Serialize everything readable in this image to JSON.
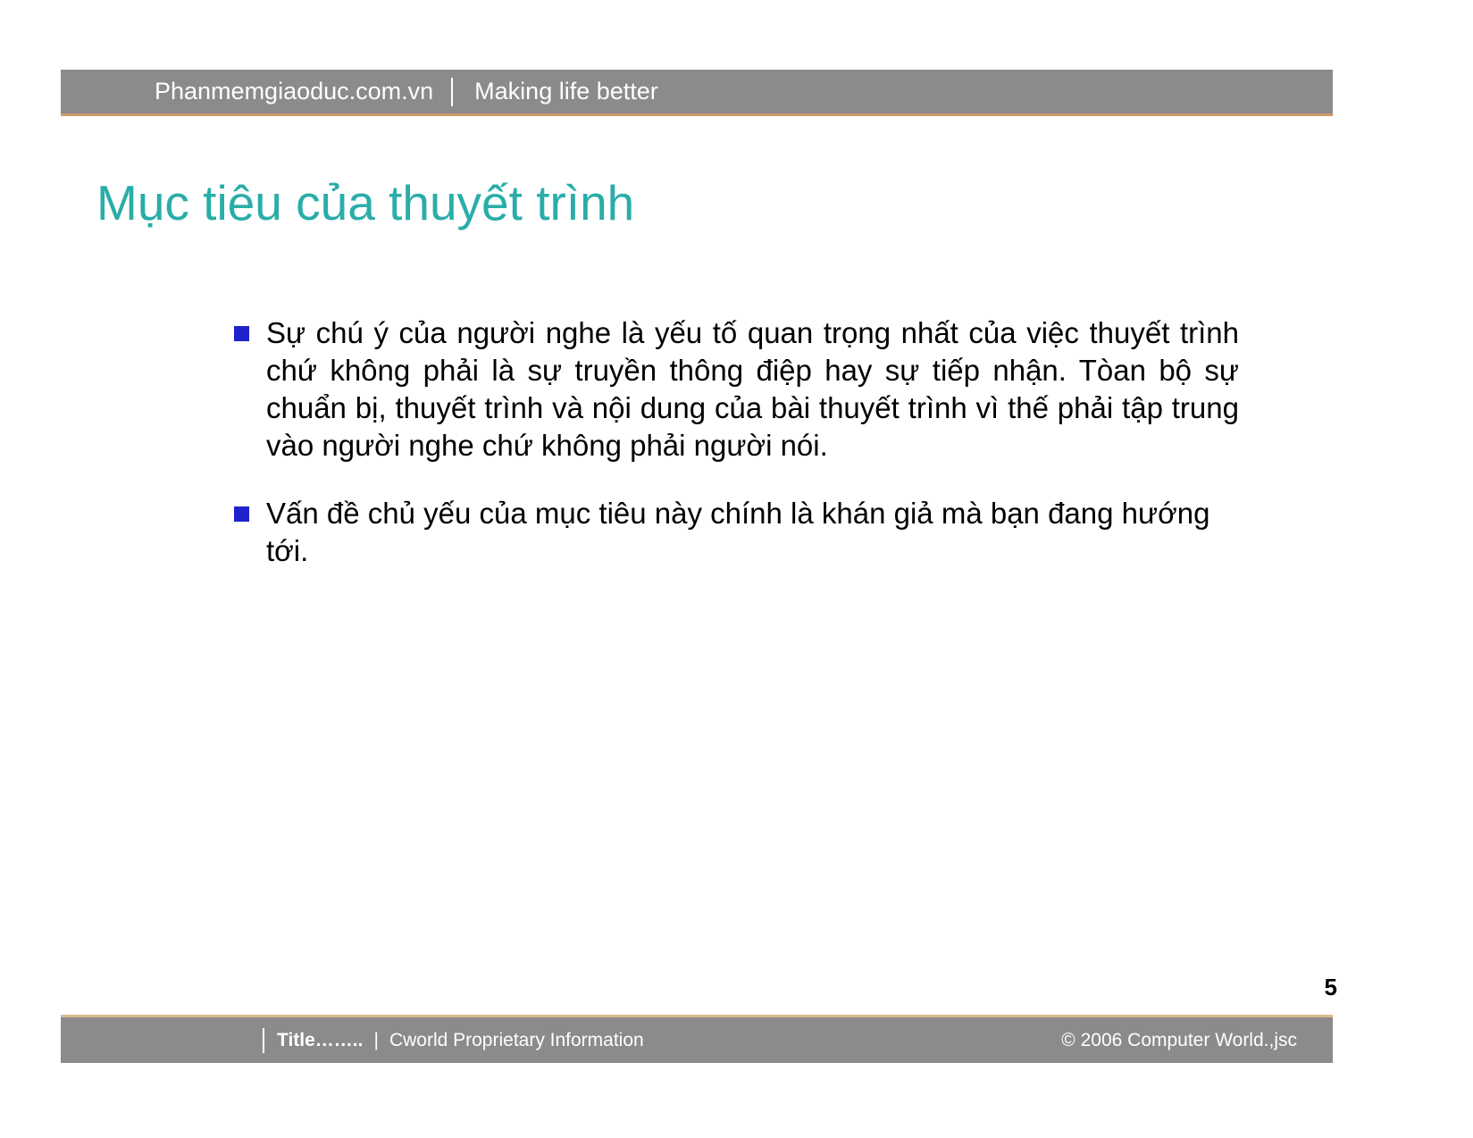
{
  "header": {
    "brand": "Phanmemgiaoduc.com.vn",
    "tagline": "Making life better",
    "separator_icon": "vertical-divider-icon",
    "band_color": "#8b8b8b",
    "accent_color": "#cc9966"
  },
  "title": {
    "text": "Mục tiêu của thuyết trình",
    "color": "#2aada8"
  },
  "body": {
    "bullet_marker_color": "#2222cc",
    "bullets": [
      {
        "text": "Sự chú ý của người nghe là yếu tố quan trọng nhất của việc thuyết trình chứ không phải là sự truyền thông điệp hay sự tiếp nhận. Tòan bộ sự chuẩn bị, thuyết trình và nội dung của bài thuyết trình vì thế phải tập trung vào người nghe chứ không phải người nói."
      },
      {
        "text": "Vấn đề chủ yếu của mục tiêu này chính là khán giả mà bạn đang hướng tới."
      }
    ]
  },
  "page_number": "5",
  "footer": {
    "title_label": "Title……..",
    "pipe": "|",
    "info": "Cworld Proprietary Information",
    "copyright": "© 2006 Computer World.,jsc",
    "band_color": "#8b8b8b",
    "accent_color": "#d9b88f"
  }
}
